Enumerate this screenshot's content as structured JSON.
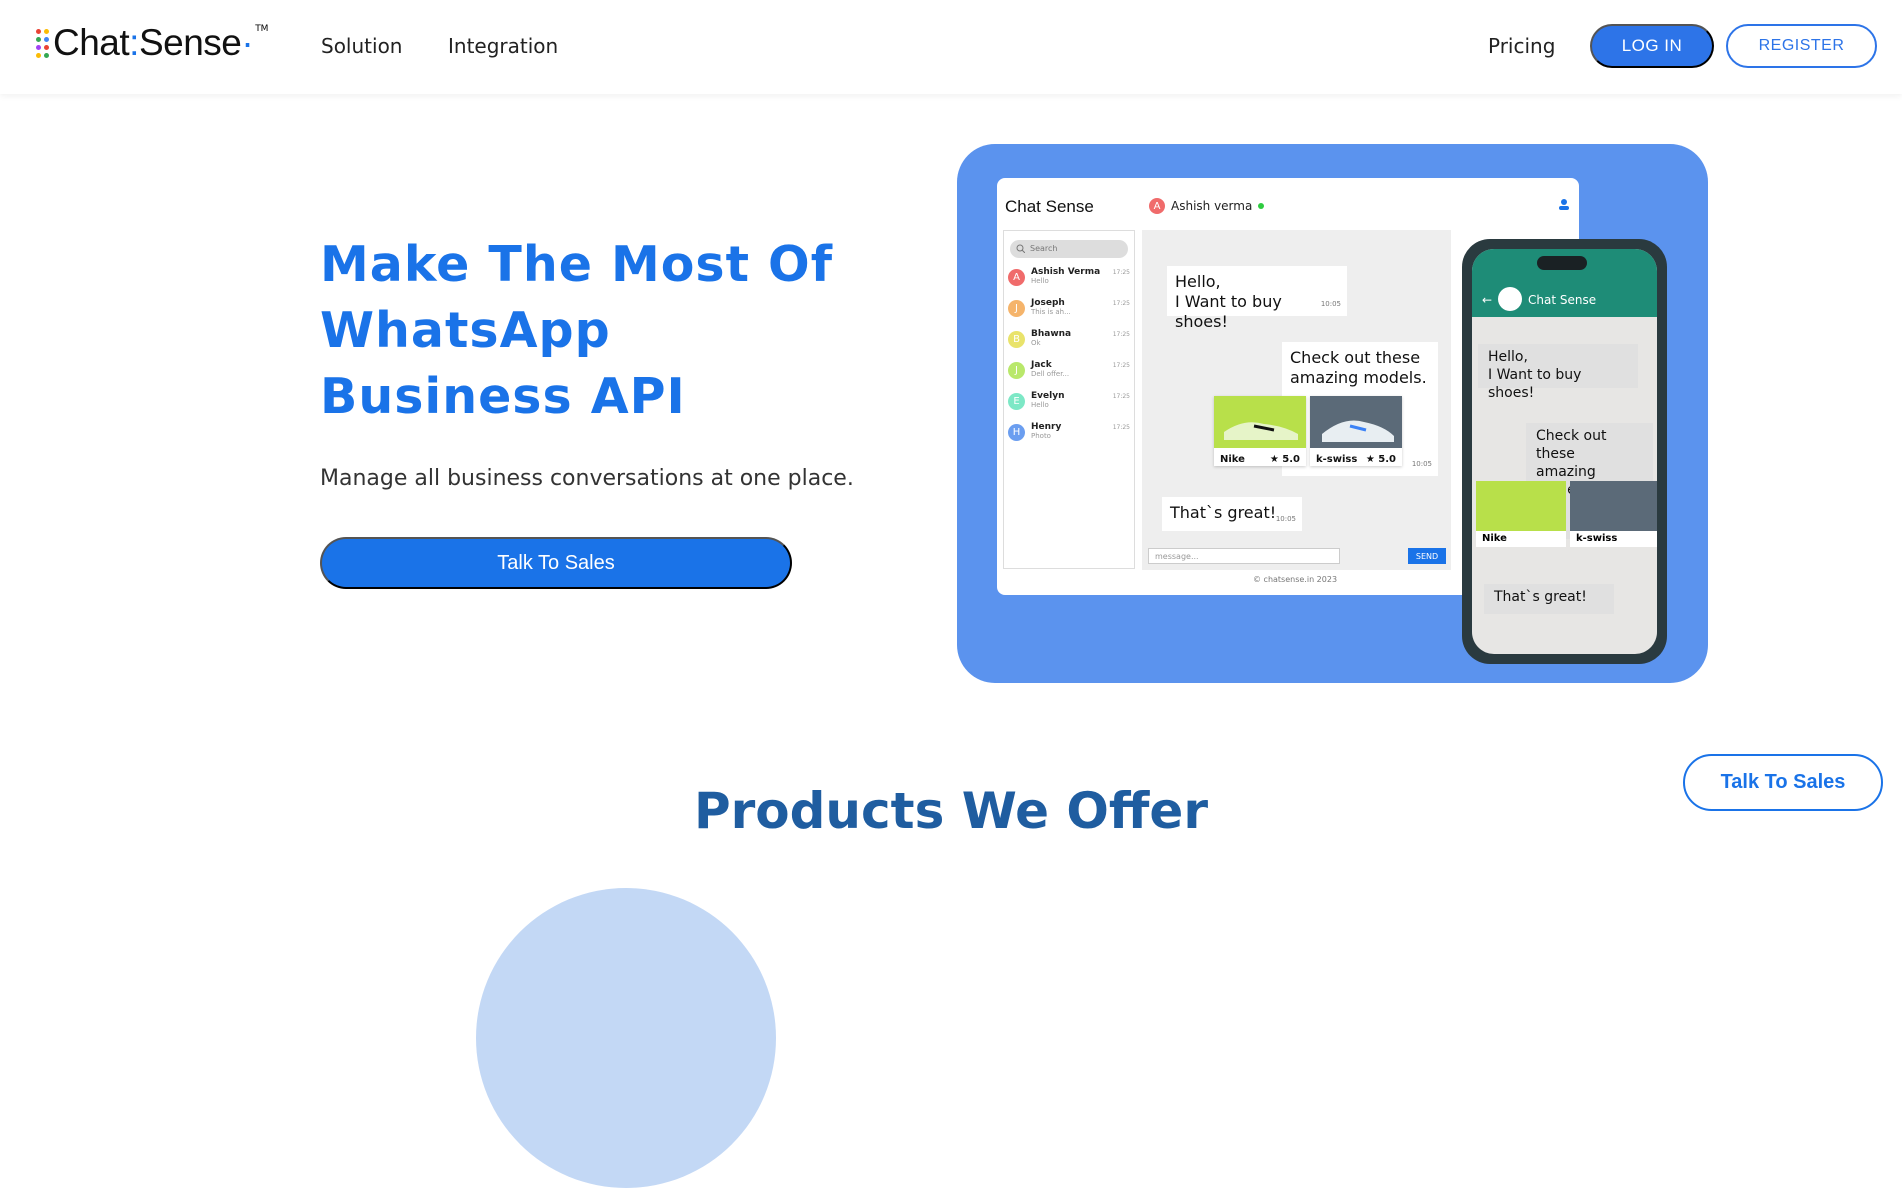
{
  "nav": {
    "logo_text": "Chat",
    "logo_text2": "Sense",
    "logo_tm": "TM",
    "links": [
      "Solution",
      "Integration"
    ],
    "pricing": "Pricing",
    "login": "LOG IN",
    "register": "REGISTER"
  },
  "hero": {
    "title": "Make The Most Of WhatsApp Business API",
    "subtitle": "Manage all business conversations at one place.",
    "cta": "Talk To Sales"
  },
  "mockup": {
    "logo": "Chat Sense",
    "contact_initial": "A",
    "contact_name": "Ashish verma",
    "search_placeholder": "Search",
    "chats": [
      {
        "initial": "A",
        "name": "Ashish Verma",
        "msg": "Hello",
        "time": "17:25",
        "color": "#f06b6b"
      },
      {
        "initial": "J",
        "name": "Joseph",
        "msg": "This is ah...",
        "time": "17:25",
        "color": "#f5b46b"
      },
      {
        "initial": "B",
        "name": "Bhawna",
        "msg": "Ok",
        "time": "17:25",
        "color": "#e9e36b"
      },
      {
        "initial": "J",
        "name": "Jack",
        "msg": "Dell offer...",
        "time": "17:25",
        "color": "#b9e86b"
      },
      {
        "initial": "E",
        "name": "Evelyn",
        "msg": "Hello",
        "time": "17:25",
        "color": "#7de8c6"
      },
      {
        "initial": "H",
        "name": "Henry",
        "msg": "Photo",
        "time": "17:25",
        "color": "#6b9ef0"
      }
    ],
    "msg1": "Hello,",
    "msg1b": "I Want to buy shoes!",
    "msg2": "Check out these",
    "msg2b": "amazing models.",
    "msg3": "That`s great!",
    "time": "10:05",
    "shoe1": "Nike",
    "shoe2": "k-swiss",
    "rating": "★ 5.0",
    "input_placeholder": "message...",
    "send": "SEND",
    "copyright": "© chatsense.in 2023",
    "phone_title": "Chat Sense"
  },
  "products": {
    "title": "Products We Offer"
  },
  "float_cta": "Talk To Sales"
}
